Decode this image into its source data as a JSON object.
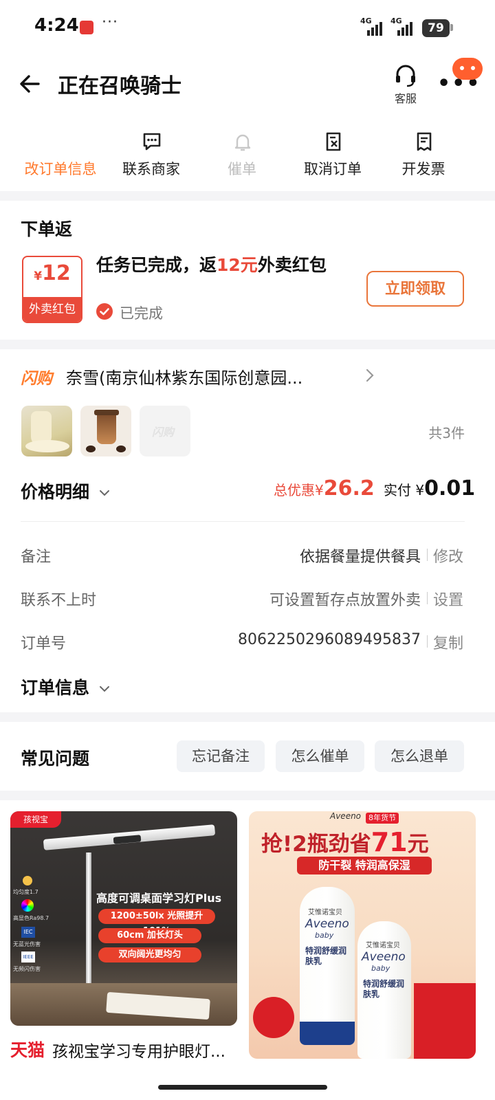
{
  "status_bar": {
    "time": "4:24",
    "dots": "···",
    "net1": "4G",
    "net2": "4G",
    "battery": "79"
  },
  "header": {
    "title": "正在召唤骑士",
    "service_label": "客服"
  },
  "actions": [
    {
      "label": "改订单信息",
      "icon": "none",
      "color": "#ff7a2e"
    },
    {
      "label": "联系商家",
      "icon": "chat-icon"
    },
    {
      "label": "催单",
      "icon": "bell-icon",
      "disabled": true
    },
    {
      "label": "取消订单",
      "icon": "cancel-doc-icon"
    },
    {
      "label": "开发票",
      "icon": "invoice-icon"
    }
  ],
  "reward": {
    "section_title": "下单返",
    "coupon_currency": "¥",
    "coupon_amount": "12",
    "coupon_label": "外卖红包",
    "task_prefix": "任务已完成，返",
    "task_highlight": "12元",
    "task_suffix": "外卖红包",
    "status": "已完成",
    "claim_button": "立即领取"
  },
  "store": {
    "badge": "闪购",
    "name": "奈雪(南京仙林紫东国际创意园...",
    "item_count": "共3件",
    "thumb_placeholder": "闪购"
  },
  "price": {
    "title": "价格明细",
    "discount_label": "总优惠",
    "discount_currency": "¥",
    "discount_value": "26.2",
    "paid_label": "实付",
    "paid_currency": "¥",
    "paid_value": "0.01"
  },
  "rows": [
    {
      "label": "备注",
      "value": "依据餐量提供餐具",
      "action": "修改"
    },
    {
      "label": "联系不上时",
      "value": "可设置暂存点放置外卖",
      "action": "设置"
    },
    {
      "label": "订单号",
      "value": "8062250296089495837",
      "action": "复制"
    }
  ],
  "order_info": {
    "title": "订单信息"
  },
  "faq": {
    "title": "常见问题",
    "chips": [
      "忘记备注",
      "怎么催单",
      "怎么退单"
    ]
  },
  "ads": {
    "ad1": {
      "brand": "孩视宝",
      "headline": "高度可调桌面学习灯Plus",
      "pills": [
        "1200±50lx 光照提升101%",
        "60cm 加长灯头",
        "双向阔光更均匀"
      ],
      "side_labels": [
        "均匀度1.7",
        "高显色Ra98.7",
        "无蓝光伤害",
        "无频闪伤害"
      ],
      "platform": "天猫",
      "title": "孩视宝学习专用护眼灯..."
    },
    "ad2": {
      "brand": "Aveeno",
      "brand_sub": "baby",
      "festival": "8年货节",
      "headline_prefix": "抢!2瓶劲省",
      "headline_num": "71",
      "headline_suffix": "元",
      "subline": "防干裂 特润高保湿",
      "product_cn": "艾惟诺宝贝",
      "product_name": "特润舒缓润肤乳"
    }
  }
}
